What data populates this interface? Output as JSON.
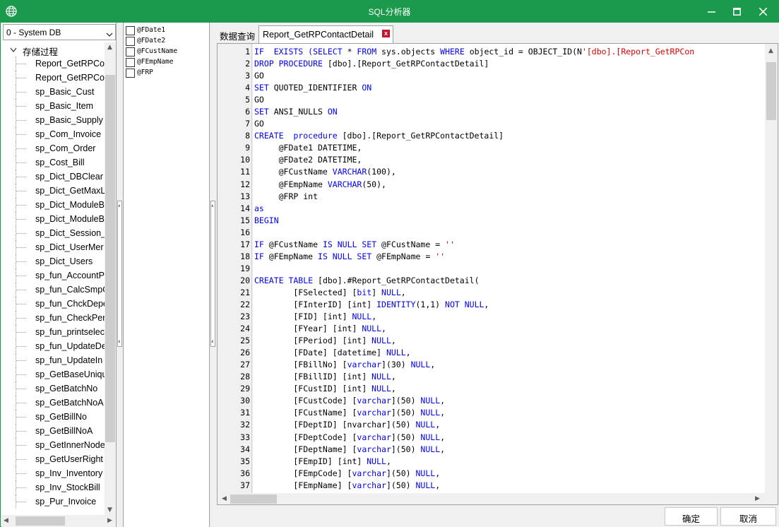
{
  "window": {
    "title": "SQL分析器"
  },
  "db_select": {
    "value": "0 - System DB"
  },
  "tree": {
    "root_label": "存储过程",
    "items": [
      "Report_GetRPCo",
      "Report_GetRPCo",
      "sp_Basic_Cust",
      "sp_Basic_Item",
      "sp_Basic_Supply",
      "sp_Com_Invoice",
      "sp_Com_Order",
      "sp_Cost_Bill",
      "sp_Dict_DBClear",
      "sp_Dict_GetMaxL",
      "sp_Dict_ModuleB",
      "sp_Dict_ModuleB",
      "sp_Dict_Session_I",
      "sp_Dict_UserMer",
      "sp_Dict_Users",
      "sp_fun_AccountPe",
      "sp_fun_CalcSmpC",
      "sp_fun_ChckDepe",
      "sp_fun_CheckPer",
      "sp_fun_printselec",
      "sp_fun_UpdateDe",
      "sp_fun_UpdateIn",
      "sp_GetBaseUniqu",
      "sp_GetBatchNo",
      "sp_GetBatchNoA",
      "sp_GetBillNo",
      "sp_GetBillNoA",
      "sp_GetInnerNode",
      "sp_GetUserRight",
      "sp_Inv_Inventory",
      "sp_Inv_StockBill",
      "sp_Pur_Invoice"
    ]
  },
  "params": [
    "@FDate1",
    "@FDate2",
    "@FCustName",
    "@FEmpName",
    "@FRP"
  ],
  "tabs": {
    "query": "数据查询",
    "report": "Report_GetRPContactDetail",
    "close_glyph": "x"
  },
  "editor": {
    "lines": [
      [
        [
          "k",
          "IF  EXISTS (SELECT "
        ],
        [
          "",
          "* "
        ],
        [
          "k",
          "FROM "
        ],
        [
          "",
          "sys.objects "
        ],
        [
          "k",
          "WHERE "
        ],
        [
          "",
          "object_id = OBJECT_ID(N"
        ],
        [
          "s",
          "'[dbo].[Report_GetRPCon"
        ]
      ],
      [
        [
          "k",
          "DROP PROCEDURE "
        ],
        [
          "",
          "[dbo].[Report_GetRPContactDetail]"
        ]
      ],
      [
        [
          "",
          "GO"
        ]
      ],
      [
        [
          "k",
          "SET "
        ],
        [
          "",
          "QUOTED_IDENTIFIER "
        ],
        [
          "k",
          "ON"
        ]
      ],
      [
        [
          "",
          "GO"
        ]
      ],
      [
        [
          "k",
          "SET "
        ],
        [
          "",
          "ANSI_NULLS "
        ],
        [
          "k",
          "ON"
        ]
      ],
      [
        [
          "",
          "GO"
        ]
      ],
      [
        [
          "k",
          "CREATE  procedure "
        ],
        [
          "",
          "[dbo].[Report_GetRPContactDetail]"
        ]
      ],
      [
        [
          "",
          "     @FDate1 DATETIME,"
        ]
      ],
      [
        [
          "",
          "     @FDate2 DATETIME,"
        ]
      ],
      [
        [
          "",
          "     @FCustName "
        ],
        [
          "k",
          "VARCHAR"
        ],
        [
          "",
          "(100),"
        ]
      ],
      [
        [
          "",
          "     @FEmpName "
        ],
        [
          "k",
          "VARCHAR"
        ],
        [
          "",
          "(50),"
        ]
      ],
      [
        [
          "",
          "     @FRP int"
        ]
      ],
      [
        [
          "k",
          "as"
        ]
      ],
      [
        [
          "k",
          "BEGIN"
        ]
      ],
      [],
      [
        [
          "k",
          "IF "
        ],
        [
          "",
          "@FCustName "
        ],
        [
          "k",
          "IS NULL SET "
        ],
        [
          "",
          "@FCustName = "
        ],
        [
          "s",
          "''"
        ]
      ],
      [
        [
          "k",
          "IF "
        ],
        [
          "",
          "@FEmpName "
        ],
        [
          "k",
          "IS NULL SET "
        ],
        [
          "",
          "@FEmpName = "
        ],
        [
          "s",
          "''"
        ]
      ],
      [],
      [
        [
          "k",
          "CREATE TABLE "
        ],
        [
          "",
          "[dbo].#Report_GetRPContactDetail("
        ]
      ],
      [
        [
          "",
          "        [FSelected] ["
        ],
        [
          "k",
          "bit"
        ],
        [
          "",
          "] "
        ],
        [
          "k",
          "NULL"
        ],
        [
          "",
          ","
        ]
      ],
      [
        [
          "",
          "        [FInterID] [int] "
        ],
        [
          "k",
          "IDENTITY"
        ],
        [
          "",
          "(1,1) "
        ],
        [
          "k",
          "NOT NULL"
        ],
        [
          "",
          ","
        ]
      ],
      [
        [
          "",
          "        [FID] [int] "
        ],
        [
          "k",
          "NULL"
        ],
        [
          "",
          ","
        ]
      ],
      [
        [
          "",
          "        [FYear] [int] "
        ],
        [
          "k",
          "NULL"
        ],
        [
          "",
          ","
        ]
      ],
      [
        [
          "",
          "        [FPeriod] [int] "
        ],
        [
          "k",
          "NULL"
        ],
        [
          "",
          ","
        ]
      ],
      [
        [
          "",
          "        [FDate] [datetime] "
        ],
        [
          "k",
          "NULL"
        ],
        [
          "",
          ","
        ]
      ],
      [
        [
          "",
          "        [FBillNo] ["
        ],
        [
          "k",
          "varchar"
        ],
        [
          "",
          "](30) "
        ],
        [
          "k",
          "NULL"
        ],
        [
          "",
          ","
        ]
      ],
      [
        [
          "",
          "        [FBillID] [int] "
        ],
        [
          "k",
          "NULL"
        ],
        [
          "",
          ","
        ]
      ],
      [
        [
          "",
          "        [FCustID] [int] "
        ],
        [
          "k",
          "NULL"
        ],
        [
          "",
          ","
        ]
      ],
      [
        [
          "",
          "        [FCustCode] ["
        ],
        [
          "k",
          "varchar"
        ],
        [
          "",
          "](50) "
        ],
        [
          "k",
          "NULL"
        ],
        [
          "",
          ","
        ]
      ],
      [
        [
          "",
          "        [FCustName] ["
        ],
        [
          "k",
          "varchar"
        ],
        [
          "",
          "](50) "
        ],
        [
          "k",
          "NULL"
        ],
        [
          "",
          ","
        ]
      ],
      [
        [
          "",
          "        [FDeptID] [nvarchar](50) "
        ],
        [
          "k",
          "NULL"
        ],
        [
          "",
          ","
        ]
      ],
      [
        [
          "",
          "        [FDeptCode] ["
        ],
        [
          "k",
          "varchar"
        ],
        [
          "",
          "](50) "
        ],
        [
          "k",
          "NULL"
        ],
        [
          "",
          ","
        ]
      ],
      [
        [
          "",
          "        [FDeptName] ["
        ],
        [
          "k",
          "varchar"
        ],
        [
          "",
          "](50) "
        ],
        [
          "k",
          "NULL"
        ],
        [
          "",
          ","
        ]
      ],
      [
        [
          "",
          "        [FEmpID] [int] "
        ],
        [
          "k",
          "NULL"
        ],
        [
          "",
          ","
        ]
      ],
      [
        [
          "",
          "        [FEmpCode] ["
        ],
        [
          "k",
          "varchar"
        ],
        [
          "",
          "](50) "
        ],
        [
          "k",
          "NULL"
        ],
        [
          "",
          ","
        ]
      ],
      [
        [
          "",
          "        [FEmpName] ["
        ],
        [
          "k",
          "varchar"
        ],
        [
          "",
          "](50) "
        ],
        [
          "k",
          "NULL"
        ],
        [
          "",
          ","
        ]
      ]
    ]
  },
  "buttons": {
    "ok": "确定",
    "cancel": "取消"
  },
  "colors": {
    "titlebar": "#1a9a4a",
    "keyword": "#0000ff",
    "string": "#e00000"
  },
  "icons": [
    "globe-icon",
    "minimize-icon",
    "maximize-icon",
    "close-icon",
    "chevron-down-icon",
    "collapse-icon",
    "tab-close-icon"
  ]
}
